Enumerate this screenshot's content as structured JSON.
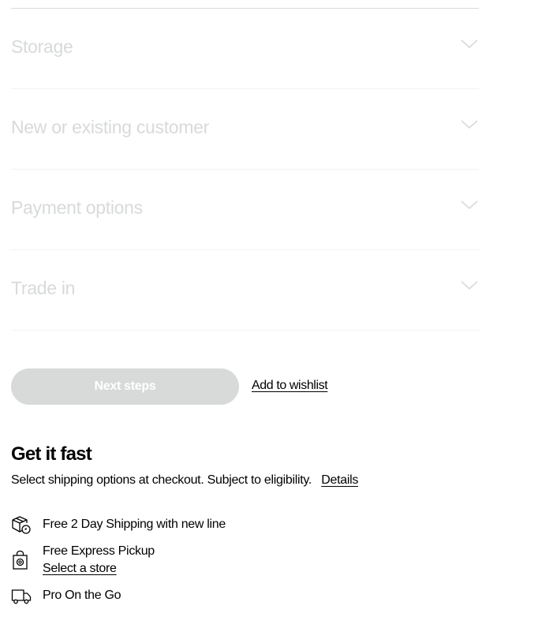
{
  "accordion": {
    "items": [
      {
        "label": "Storage",
        "icon": "chevron-down-icon"
      },
      {
        "label": "New or existing customer",
        "icon": "chevron-down-icon"
      },
      {
        "label": "Payment options",
        "icon": "chevron-down-icon"
      },
      {
        "label": "Trade in",
        "icon": "chevron-down-icon"
      }
    ],
    "label_color": "#d8dada"
  },
  "actions": {
    "next_label": "Next steps",
    "next_disabled": true,
    "next_bg": "#d8dada",
    "wishlist_label": "Add to wishlist"
  },
  "get_it_fast": {
    "title": "Get it fast",
    "description": "Select shipping options at checkout. Subject to eligibility.",
    "details_label": "Details",
    "options": [
      {
        "icon": "shipping-box-icon",
        "label": "Free 2 Day Shipping with new line"
      },
      {
        "icon": "shopping-bag-icon",
        "label": "Free Express Pickup",
        "link_label": "Select a store"
      },
      {
        "icon": "delivery-truck-icon",
        "label": "Pro On the Go"
      }
    ]
  }
}
